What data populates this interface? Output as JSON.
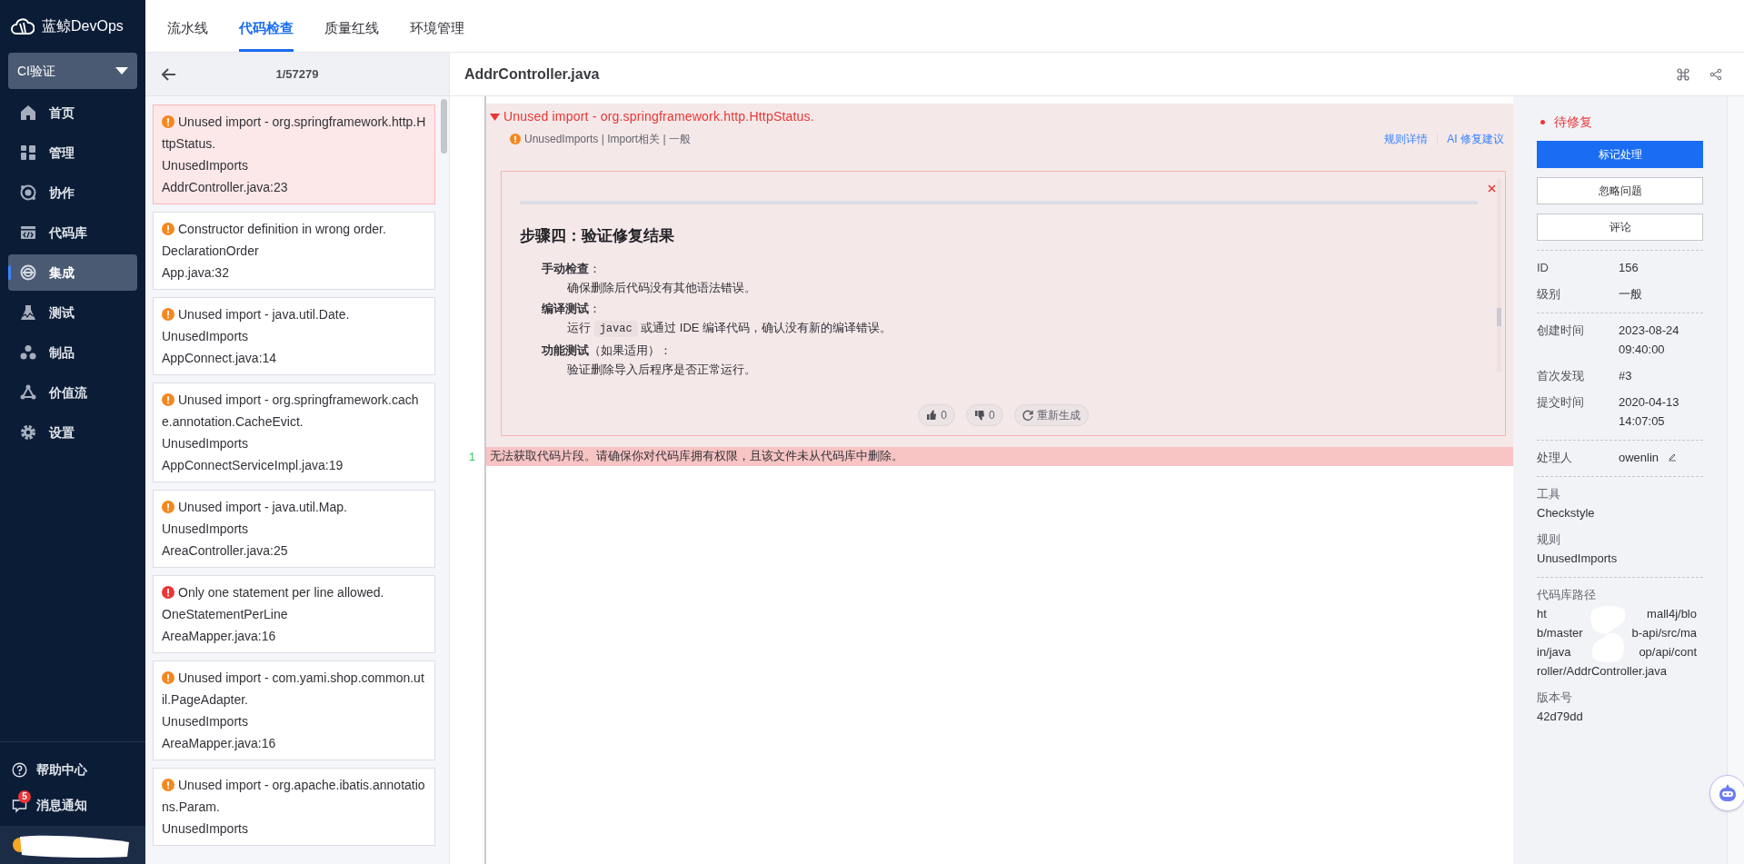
{
  "brand": {
    "name": "蓝鲸DevOps"
  },
  "project_selector": {
    "value": "CI验证"
  },
  "nav": [
    {
      "label": "首页",
      "selected": false
    },
    {
      "label": "管理",
      "selected": false
    },
    {
      "label": "协作",
      "selected": false
    },
    {
      "label": "代码库",
      "selected": false
    },
    {
      "label": "集成",
      "selected": true
    },
    {
      "label": "测试",
      "selected": false
    },
    {
      "label": "制品",
      "selected": false
    },
    {
      "label": "价值流",
      "selected": false
    },
    {
      "label": "设置",
      "selected": false
    }
  ],
  "nav_footer": [
    {
      "kind": "help",
      "label": "帮助中心"
    },
    {
      "kind": "messages",
      "label": "消息通知",
      "badge": "5"
    }
  ],
  "top_tabs": [
    {
      "label": "流水线",
      "selected": false
    },
    {
      "label": "代码检查",
      "selected": true
    },
    {
      "label": "质量红线",
      "selected": false
    },
    {
      "label": "环境管理",
      "selected": false
    }
  ],
  "issue_list": {
    "counter": "1/57279",
    "items": [
      {
        "message": "Unused import - org.springframework.http.HttpStatus.",
        "rule": "UnusedImports",
        "location": "AddrController.java:23",
        "color": "#f5871f",
        "selected": true
      },
      {
        "message": "Constructor definition in wrong order.",
        "rule": "DeclarationOrder",
        "location": "App.java:32",
        "color": "#f5871f",
        "selected": false
      },
      {
        "message": "Unused import - java.util.Date.",
        "rule": "UnusedImports",
        "location": "AppConnect.java:14",
        "color": "#f5871f",
        "selected": false
      },
      {
        "message": "Unused import - org.springframework.cache.annotation.CacheEvict.",
        "rule": "UnusedImports",
        "location": "AppConnectServiceImpl.java:19",
        "color": "#f5871f",
        "selected": false
      },
      {
        "message": "Unused import - java.util.Map.",
        "rule": "UnusedImports",
        "location": "AreaController.java:25",
        "color": "#f5871f",
        "selected": false
      },
      {
        "message": "Only one statement per line allowed.",
        "rule": "OneStatementPerLine",
        "location": "AreaMapper.java:16",
        "color": "#ea3636",
        "selected": false
      },
      {
        "message": "Unused import - com.yami.shop.common.util.PageAdapter.",
        "rule": "UnusedImports",
        "location": "AreaMapper.java:16",
        "color": "#f5871f",
        "selected": false
      },
      {
        "message": "Unused import - org.apache.ibatis.annotations.Param.",
        "rule": "UnusedImports",
        "color": "#f5871f",
        "selected": false
      }
    ]
  },
  "file_title": "AddrController.java",
  "issue_detail": {
    "title": "Unused import - org.springframework.http.HttpStatus.",
    "expanded": true,
    "color": "#f5871f",
    "meta": "UnusedImports | Import相关 | 一般",
    "links": [
      "规则详情",
      "AI 修复建议"
    ],
    "ai_suggestion": {
      "heading": "步骤四：验证修复结果",
      "steps": [
        {
          "title": "**手动检查**：",
          "segments": [
            {
              "kind": "text",
              "text": "确保删除后代码没有其他语法错误。"
            }
          ]
        },
        {
          "title": "**编译测试**：",
          "segments": [
            {
              "kind": "text",
              "text": "运行 "
            },
            {
              "kind": "code",
              "text": "javac"
            },
            {
              "kind": "text",
              "text": " 或通过 IDE 编译代码，确认没有新的编译错误。"
            }
          ]
        },
        {
          "title": "**功能测试**（如果适用）：",
          "segments": [
            {
              "kind": "text",
              "text": "验证删除导入后程序是否正常运行。"
            }
          ]
        }
      ],
      "feedback": [
        {
          "kind": "like",
          "label": "0"
        },
        {
          "kind": "dislike",
          "label": "0"
        },
        {
          "kind": "regenerate",
          "label": "重新生成"
        }
      ]
    }
  },
  "code_lines": [
    {
      "number": "1",
      "text": "无法获取代码片段。请确保你对代码库拥有权限，且该文件未从代码库中删除。",
      "highlighted": true
    }
  ],
  "details": {
    "status": {
      "label": "待修复",
      "color": "#ea3636"
    },
    "actions": [
      {
        "label": "标记处理",
        "primary": true
      },
      {
        "label": "忽略问题",
        "primary": false
      },
      {
        "label": "评论",
        "primary": false
      }
    ],
    "groups": [
      [
        {
          "kind": "inline",
          "label": "ID",
          "value": "156"
        },
        {
          "kind": "inline",
          "label": "级别",
          "value": "一般"
        }
      ],
      [
        {
          "kind": "inline",
          "label": "创建时间",
          "value": "2023-08-24 09:40:00"
        },
        {
          "kind": "inline",
          "label": "首次发现",
          "value": "#3"
        },
        {
          "kind": "inline",
          "label": "提交时间",
          "value": "2020-04-13 14:07:05"
        }
      ],
      [
        {
          "kind": "editable",
          "label": "处理人",
          "value": "owenlin"
        }
      ],
      [
        {
          "kind": "stacked",
          "label": "工具",
          "value": "Checkstyle"
        },
        {
          "kind": "stacked",
          "label": "规则",
          "value": "UnusedImports"
        }
      ],
      [
        {
          "kind": "redacted",
          "label": "代码库路径",
          "lines": [
            {
              "before": "ht",
              "after": "mall4j/blo"
            },
            {
              "before": "b/master",
              "after": "b-api/src/ma"
            },
            {
              "before": "in/java",
              "after": "op/api/cont"
            },
            {
              "before": "roller/AddrController.java"
            }
          ]
        },
        {
          "kind": "stacked",
          "label": "版本号",
          "value": "42d79dd"
        }
      ]
    ]
  }
}
